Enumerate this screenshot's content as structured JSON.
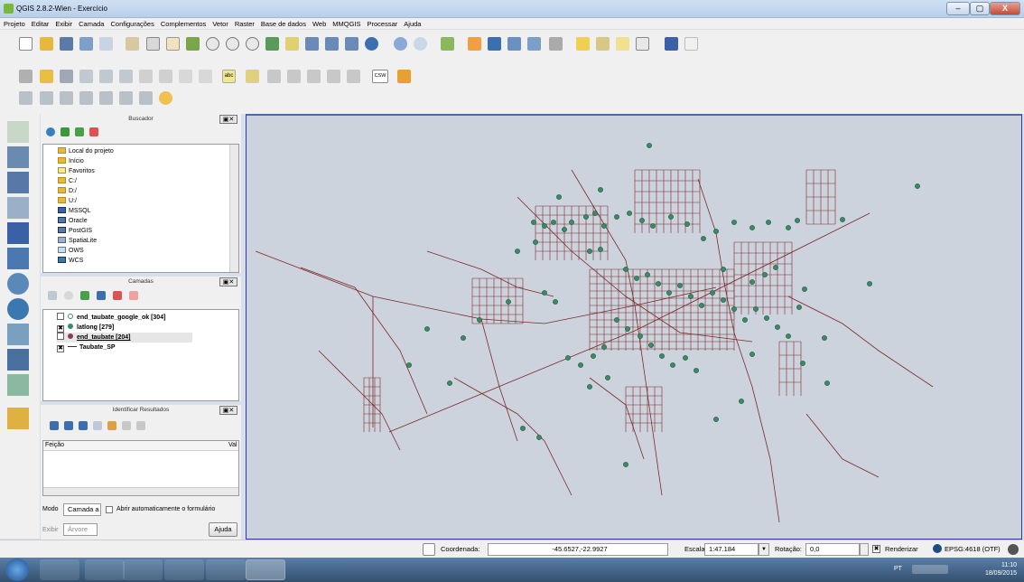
{
  "app": {
    "title": "QGIS 2.8.2-Wien - Exercício"
  },
  "window_controls": {
    "minimize": "–",
    "maximize": "▢",
    "close": "X"
  },
  "menu": [
    "Projeto",
    "Editar",
    "Exibir",
    "Camada",
    "Configurações",
    "Complementos",
    "Vetor",
    "Raster",
    "Base de dados",
    "Web",
    "MMQGIS",
    "Processar",
    "Ajuda"
  ],
  "toolbar_icons": {
    "text_label": "abc",
    "csv_label": "CSW"
  },
  "browser": {
    "title": "Buscador",
    "items": [
      "Local do projeto",
      "Início",
      "Favoritos",
      "C:/",
      "D:/",
      "U:/",
      "MSSQL",
      "Oracle",
      "PostGIS",
      "SpatiaLite",
      "OWS",
      "WCS"
    ]
  },
  "layers": {
    "title": "Camadas",
    "items": [
      {
        "name": "end_taubate_google_ok [304]",
        "checked": false
      },
      {
        "name": "latlong [279]",
        "checked": true
      },
      {
        "name": "end_taubate [204]",
        "checked": false
      },
      {
        "name": "Taubate_SP",
        "checked": true
      }
    ]
  },
  "identify": {
    "title": "Identificar Resultados",
    "col_feature": "Feição",
    "col_value": "Val",
    "mode_label": "Modo",
    "mode_value": "Camada a",
    "auto_open_label": "Abrir automaticamente o formulário",
    "view_label": "Exibir",
    "view_value": "Árvore",
    "help_button": "Ajuda"
  },
  "status": {
    "coord_label": "Coordenada:",
    "coord_value": "-45.6527,-22.9927",
    "scale_label": "Escala",
    "scale_value": "1:47.184",
    "rotation_label": "Rotação:",
    "rotation_value": "0,0",
    "render_label": "Renderizar",
    "crs_label": "EPSG:4618 (OTF)"
  },
  "taskbar": {
    "lang": "PT",
    "time": "11:10",
    "date": "18/09/2015"
  },
  "colors": {
    "roads": "#7a2a2a",
    "points_fill": "#3a8c66",
    "points_stroke": "#1e4d38",
    "map_bg": "#cdd3dc"
  }
}
